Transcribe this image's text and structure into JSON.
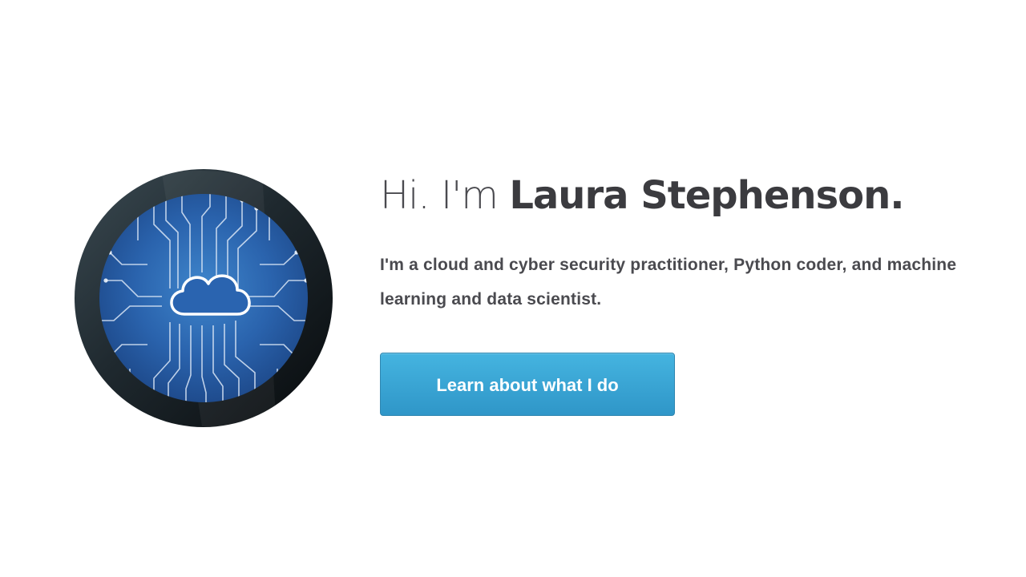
{
  "hero": {
    "greeting": "Hi. I'm ",
    "name": "Laura Stephenson.",
    "bio": "I'm a cloud and cyber security practitioner, Python coder, and machine learning and data scientist.",
    "cta_label": "Learn about what I do"
  },
  "avatar": {
    "icon": "cloud-circuit-icon",
    "description_colors": {
      "ring": "#1a2126",
      "board": "#2a62a8",
      "traces": "#dbe7f6"
    }
  },
  "colors": {
    "text": "#39393d",
    "button": "#3aa7d8",
    "button_text": "#ffffff",
    "background": "#ffffff"
  }
}
